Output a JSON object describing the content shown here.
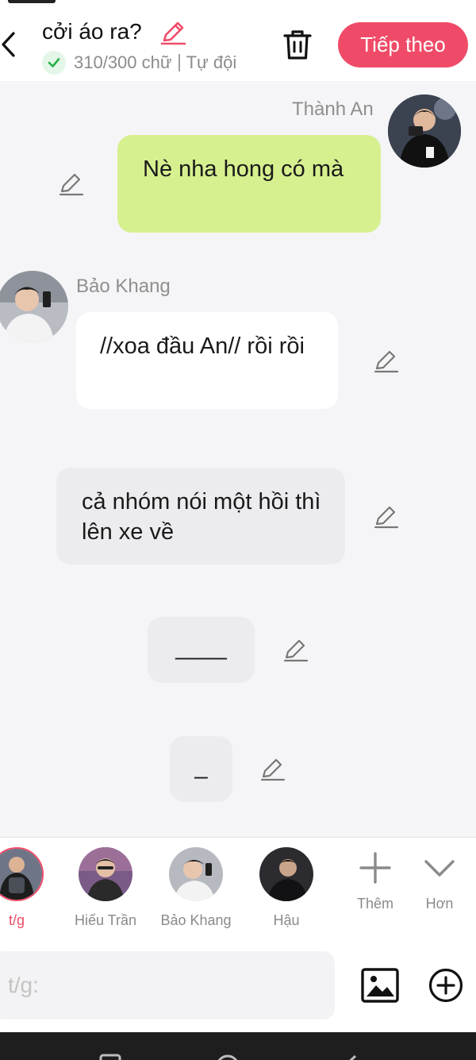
{
  "header": {
    "title": "cởi áo ra?",
    "word_count": "310/300 chữ",
    "mode": "Tự đội",
    "next_label": "Tiếp theo"
  },
  "messages": [
    {
      "sender": "Thành An",
      "text": "Nè nha hong có mà",
      "side": "right",
      "bubble_color": "#d7f08f"
    },
    {
      "sender": "Bảo Khang",
      "text": "//xoa đầu An// rồi rồi",
      "side": "left",
      "bubble_color": "#ffffff"
    },
    {
      "sender": "",
      "text": "cả nhóm nói một hồi thì lên xe về",
      "side": "narration",
      "bubble_color": "#ececef"
    },
    {
      "sender": "",
      "text": "____",
      "side": "narration",
      "bubble_color": "#ececef"
    },
    {
      "sender": "",
      "text": "_",
      "side": "narration",
      "bubble_color": "#ececef"
    }
  ],
  "characters": [
    {
      "name": "t/g",
      "selected": true
    },
    {
      "name": "Hiếu Trần",
      "selected": false
    },
    {
      "name": "Bảo Khang",
      "selected": false
    },
    {
      "name": "Hậu",
      "selected": false
    }
  ],
  "actions": {
    "add_label": "Thêm",
    "more_label": "Hơn"
  },
  "input": {
    "placeholder": "t/g:"
  },
  "colors": {
    "accent": "#ef4b68",
    "bubble_right": "#d7f08f",
    "bubble_left": "#ffffff",
    "bubble_narration": "#ececef",
    "success": "#27b04a"
  },
  "icons": [
    "back-icon",
    "pencil-icon",
    "check-icon",
    "trash-icon",
    "plus-icon",
    "chevron-down-icon",
    "image-icon",
    "add-circle-icon"
  ]
}
